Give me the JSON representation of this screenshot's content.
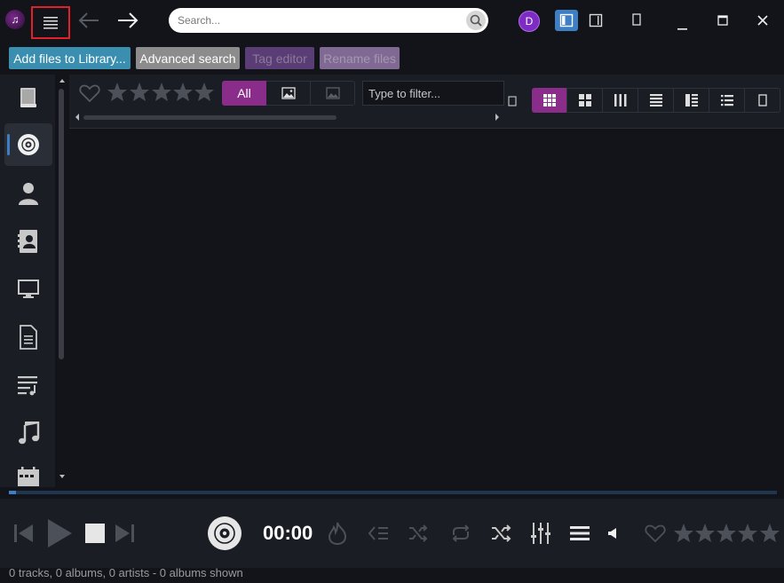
{
  "titlebar": {
    "search_placeholder": "Search...",
    "avatar_initial": "D"
  },
  "toolbar": {
    "add_files_label": "Add files to Library...",
    "advanced_search_label": "Advanced search",
    "tag_editor_label": "Tag editor",
    "rename_files_label": "Rename files"
  },
  "sidebar": {
    "items": [
      {
        "name": "library",
        "icon": "books-icon"
      },
      {
        "name": "albums",
        "icon": "disc-icon",
        "active": true
      },
      {
        "name": "artists",
        "icon": "person-icon"
      },
      {
        "name": "contacts",
        "icon": "contact-book-icon"
      },
      {
        "name": "devices",
        "icon": "monitor-icon"
      },
      {
        "name": "documents",
        "icon": "document-icon"
      },
      {
        "name": "playlists",
        "icon": "playlist-icon"
      },
      {
        "name": "music",
        "icon": "music-note-icon"
      },
      {
        "name": "calendar",
        "icon": "calendar-icon"
      }
    ]
  },
  "filter": {
    "segment_all_label": "All",
    "filter_placeholder": "Type to filter..."
  },
  "player": {
    "time": "00:00"
  },
  "status": {
    "text": "0 tracks, 0 albums, 0 artists - 0 albums shown"
  },
  "colors": {
    "accent_purple": "#8a2d8a",
    "accent_blue": "#3d7fc4",
    "background": "#12141a",
    "panel": "#1a1d24"
  }
}
